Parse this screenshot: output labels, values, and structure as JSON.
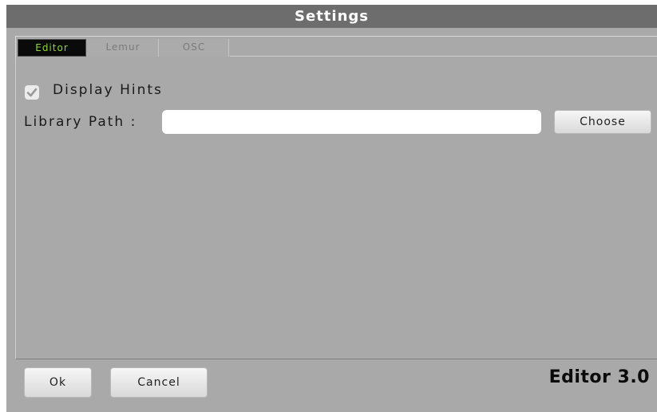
{
  "window": {
    "title": "Settings",
    "version": "Editor 3.0"
  },
  "tabs": [
    {
      "label": "Editor",
      "active": true
    },
    {
      "label": "Lemur",
      "active": false
    },
    {
      "label": "OSC",
      "active": false
    }
  ],
  "editor": {
    "display_hints": {
      "label": "Display Hints",
      "checked": true
    },
    "library_path": {
      "label": "Library Path :",
      "value": "",
      "placeholder": ""
    },
    "choose_label": "Choose"
  },
  "footer": {
    "ok_label": "Ok",
    "cancel_label": "Cancel"
  },
  "colors": {
    "titlebar": "#6d6d6d",
    "background": "#a9a9a9",
    "active_tab_bg": "#0a0a0a",
    "active_tab_text": "#8cd63e"
  },
  "icons": {
    "checkbox": "check-icon"
  }
}
